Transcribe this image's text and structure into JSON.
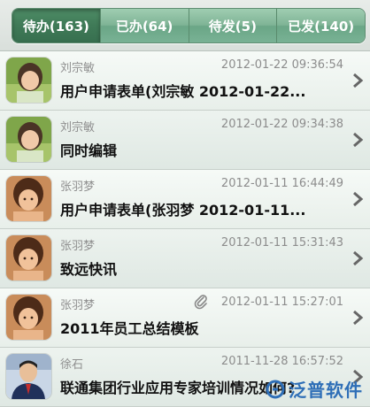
{
  "tabs": [
    {
      "label": "待办(163)",
      "active": true
    },
    {
      "label": "已办(64)",
      "active": false
    },
    {
      "label": "待发(5)",
      "active": false
    },
    {
      "label": "已发(140)",
      "active": false
    }
  ],
  "items": [
    {
      "name": "刘宗敏",
      "time": "2012-01-22 09:36:54",
      "title": "用户申请表单(刘宗敏 2012-01-22...",
      "avatar": "avatar-green",
      "attachment": false
    },
    {
      "name": "刘宗敏",
      "time": "2012-01-22 09:34:38",
      "title": "同时编辑",
      "avatar": "avatar-green",
      "attachment": false
    },
    {
      "name": "张羽梦",
      "time": "2012-01-11 16:44:49",
      "title": "用户申请表单(张羽梦 2012-01-11...",
      "avatar": "avatar-child",
      "attachment": false
    },
    {
      "name": "张羽梦",
      "time": "2012-01-11 15:31:43",
      "title": "致远快讯",
      "avatar": "avatar-child",
      "attachment": false
    },
    {
      "name": "张羽梦",
      "time": "2012-01-11 15:27:01",
      "title": "2011年员工总结模板",
      "avatar": "avatar-child",
      "attachment": true
    },
    {
      "name": "徐石",
      "time": "2011-11-28 16:57:52",
      "title": "联通集团行业应用专家培训情况如何?",
      "avatar": "avatar-man",
      "attachment": false
    }
  ],
  "watermark": {
    "text": "泛普软件"
  },
  "colors": {
    "accent": "#3f7a57",
    "tab": "#7fb496",
    "brand_watermark": "#2f6fb7"
  }
}
